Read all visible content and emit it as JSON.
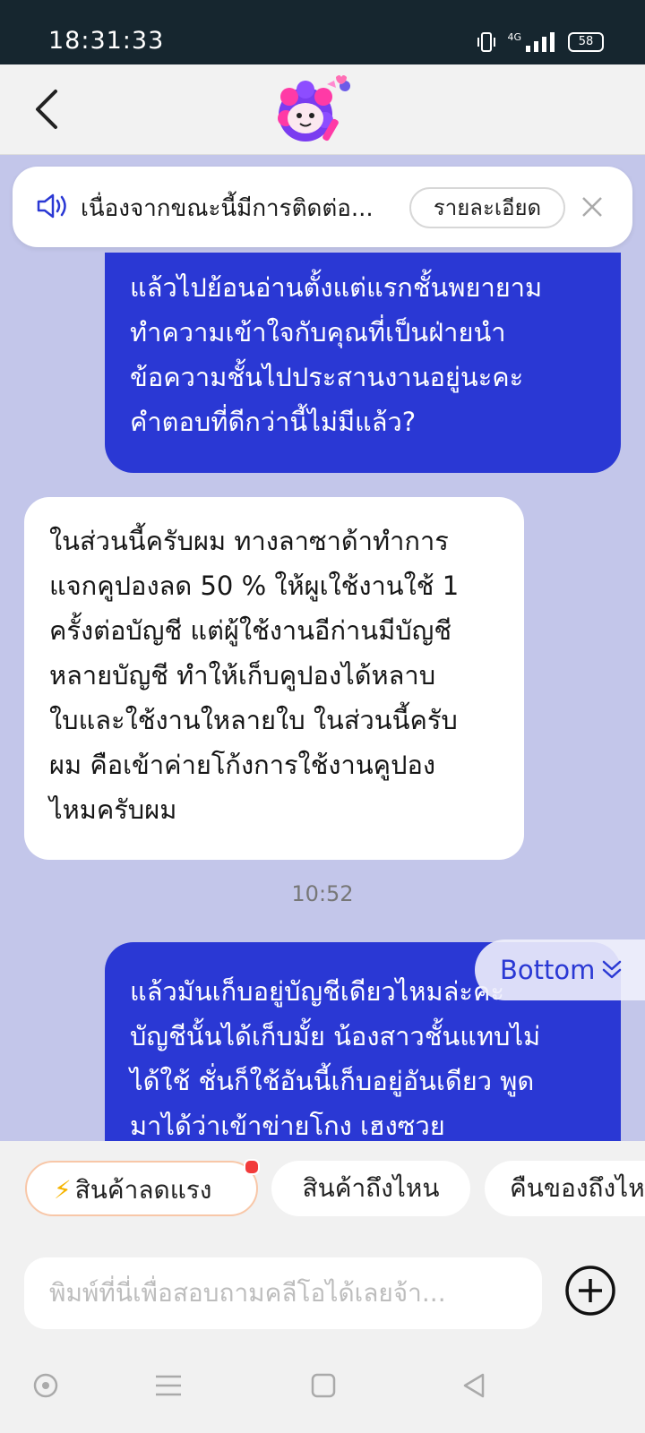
{
  "status_bar": {
    "time": "18:31:33",
    "network": "4G",
    "battery": "58"
  },
  "header": {
    "back_icon": "chevron-left-icon",
    "logo_icon": "mascot-logo-icon"
  },
  "notice": {
    "text": "เนื่องจากขณะนี้มีการติดต่อ...",
    "detail_button": "รายละเอียด",
    "speaker_icon": "speaker-icon",
    "close_icon": "close-icon"
  },
  "messages": [
    {
      "role": "user",
      "lines": [
        "แล้วไปย้อนอ่านตั้งแต่แรกชั้นพยายาม",
        "ทำความเข้าใจกับคุณที่เป็นฝ่ายนำ",
        "ข้อความชั้นไปประสานงานอยู่นะคะ",
        "คำตอบที่ดีกว่านี้ไม่มีแล้ว?"
      ]
    },
    {
      "role": "bot",
      "lines": [
        "ในส่วนนี้ครับผม ทางลาซาด้าทำการ",
        "แจกคูปองลด 50 % ให้ผูเใช้งานใช้ 1",
        "ครั้งต่อบัญชี แต่ผู้ใช้งานอีก่านมีบัญชี",
        "หลายบัญชี ทำให้เก็บคูปองได้หลาบ",
        "ใบและใช้งานใหลายใบ ในส่วนนี้ครับ",
        "ผม คือเข้าค่ายโก้งการใช้งานคูปอง",
        "ไหมครับผม"
      ]
    },
    {
      "role": "user",
      "lines": [
        "แล้วมันเก็บอยู่บัญชีเดียวไหมล่ะคะ",
        "บัญชีนั้นได้เก็บมั้ย  น้องสาวชั้นแทบไม่",
        "ได้ใช้ ชั่นก็ใช้อันนี้เก็บอยู่อันเดียว พูด",
        "มาได้ว่าเข้าข่ายโกง เฮงซวย"
      ]
    }
  ],
  "timestamp": "10:52",
  "scroll_button": {
    "label": "Bottom",
    "icon": "double-chevron-down-icon"
  },
  "quick_replies": [
    {
      "label": "สินค้าลดแรง",
      "icon": "lightning-icon",
      "has_dot": true
    },
    {
      "label": "สินค้าถึงไหน"
    },
    {
      "label": "คืนของถึงไห"
    }
  ],
  "input": {
    "placeholder": "พิมพ์ที่นี่เพื่อสอบถามคลีโอได้เลยจ้า..."
  },
  "colors": {
    "user_bubble": "#2a38d4",
    "chat_bg": "#c3c6ea",
    "status_bar": "#16262f"
  }
}
